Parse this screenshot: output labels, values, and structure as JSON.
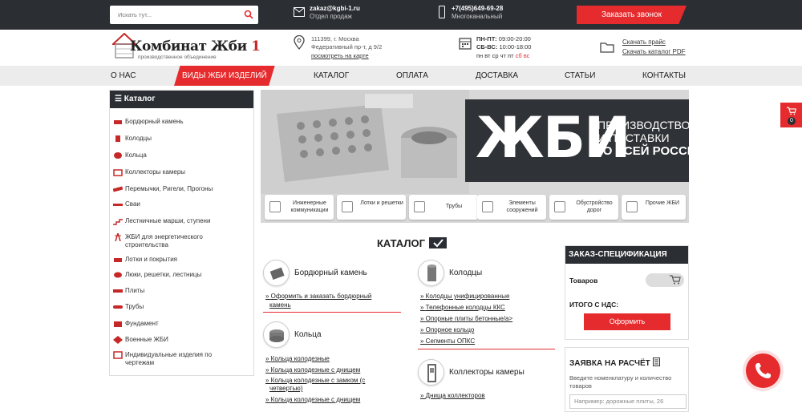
{
  "topbar": {
    "search_placeholder": "Искать тут...",
    "email": "zakaz@kgbi-1.ru",
    "email_sub": "Отдел продаж",
    "phone": "+7(495)649-69-28",
    "phone_sub": "Многоканальный",
    "call_button": "Заказать звонок"
  },
  "logo": {
    "name_main": "Комбинат Жби",
    "name_num": " 1",
    "subtitle": "производственное объединение"
  },
  "address": {
    "line1": "111399, г. Москва",
    "line2": "Федеративный пр-т, д 9/2",
    "map_link": "посмотреть на карте"
  },
  "schedule": {
    "l1_b": "ПН-ПТ:",
    "l1": " 09:00-20:00",
    "l2_b": "СБ-ВС:",
    "l2": " 10:00-18:00",
    "l3": "пн вт ср чт пт ",
    "l3_red": "сб вс"
  },
  "downloads": {
    "price": "Скачать прайс",
    "catalog": "Скачать каталог PDF"
  },
  "nav": [
    "О НАС",
    "ВИДЫ ЖБИ ИЗДЕЛИЙ",
    "КАТАЛОГ",
    "ОПЛАТА",
    "ДОСТАВКА",
    "СТАТЬИ",
    "КОНТАКТЫ"
  ],
  "sidebar": {
    "title": "Каталог",
    "items": [
      "Бордюрный камень",
      "Колодцы",
      "Кольца",
      "Коллекторы камеры",
      "Перемычки, Ригели, Прогоны",
      "Сваи",
      "Лестничные марши, ступени",
      "ЖБИ для энергетического",
      "строительства",
      "Лотки и покрытия",
      "Люки, решетки, лестницы",
      "Плиты",
      "Трубы",
      "Фундамент",
      "Военные ЖБИ",
      "Индивидуальные изделия по",
      "чертежам"
    ]
  },
  "banner": {
    "big": "ЖБИ",
    "s1": "ПРОИЗВОДСТВО",
    "s2": "И ПОСТАВКИ",
    "s3": "ПО ВСЕЙ РОССИИ",
    "buttons": [
      "Инженерные коммуникации",
      "Лотки и решетки",
      "Трубы",
      "Элементы сооружений",
      "Обустройство дорог",
      "Прочие ЖБИ"
    ]
  },
  "catalog": {
    "title": "КАТАЛОГ",
    "sections": {
      "bordur": {
        "title": "Бордюрный камень",
        "links": [
          "Оформить и заказать бордюрный",
          "камень"
        ]
      },
      "kolodcy": {
        "title": "Колодцы",
        "links": [
          "Колодцы унифицированные",
          "Телефонные колодцы ККС",
          "Опорные плиты бетонные/а>",
          "Опорное кольцо",
          "Сегменты ОПКС"
        ]
      },
      "kolca": {
        "title": "Кольца",
        "links": [
          "Кольца колодезные",
          "Кольца колодезные с днищем",
          "Кольца колодезные с замком (с",
          "четвертью)",
          "Кольца колодезные с днищем"
        ]
      },
      "kollektory": {
        "title": "Коллекторы камеры",
        "links": [
          "Днища коллекторов"
        ]
      }
    }
  },
  "order": {
    "title": "ЗАКАЗ-СПЕЦИФИКАЦИЯ",
    "items_label": "Товаров",
    "total_label": "ИТОГО С НДС:",
    "button": "Оформить"
  },
  "request": {
    "title": "ЗАЯВКА НА РАСЧЁТ",
    "text": "Введите номенклатуру и количество товаров",
    "placeholder": "Например: дорожные плиты, 26"
  },
  "side_cart_count": "0",
  "colors": {
    "accent": "#e52b2d",
    "dark": "#2b2e33"
  }
}
